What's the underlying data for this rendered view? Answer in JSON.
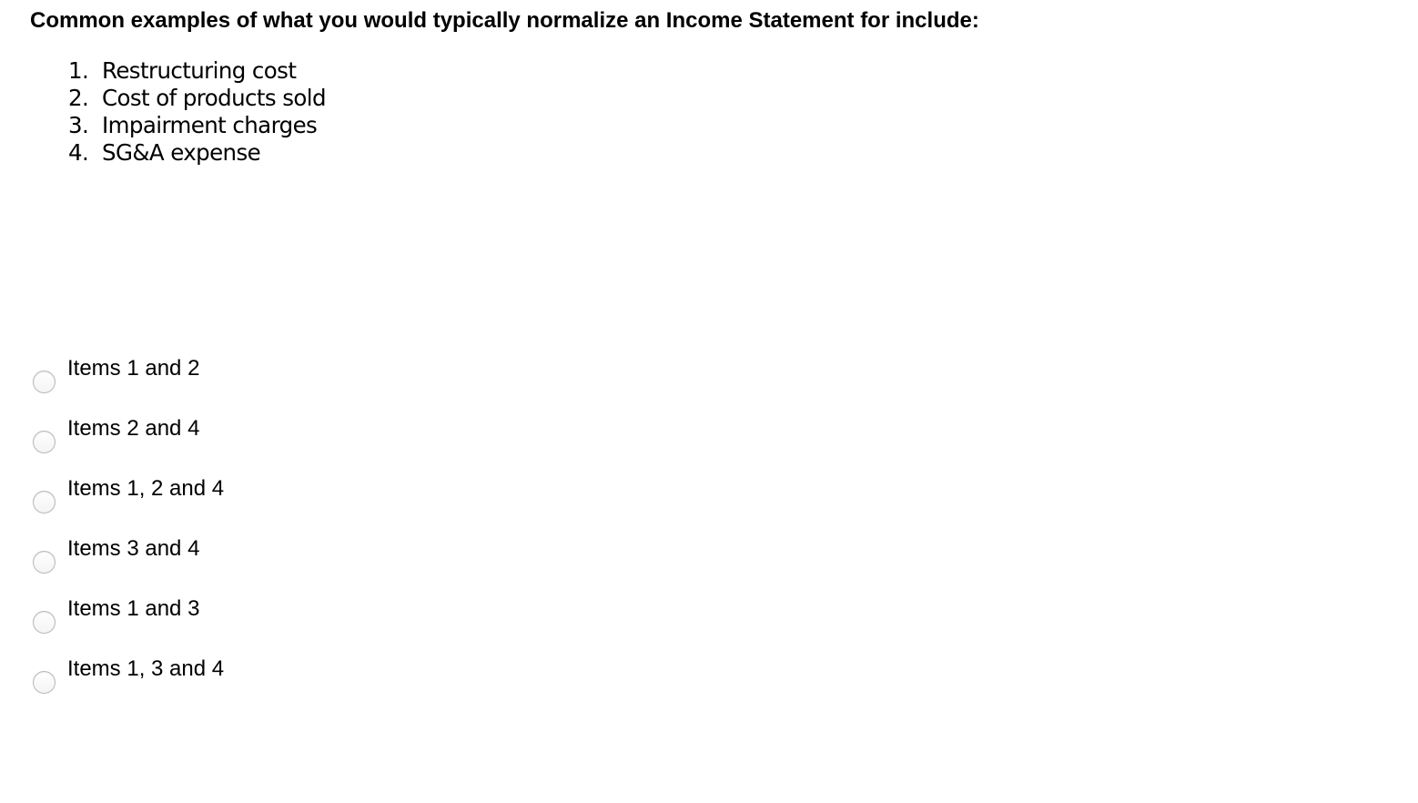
{
  "question": {
    "prompt": "Common examples of what you would typically normalize an Income Statement for include:",
    "examples": [
      {
        "number": "1.",
        "text": "Restructuring cost"
      },
      {
        "number": "2.",
        "text": "Cost of products sold"
      },
      {
        "number": "3.",
        "text": "Impairment charges"
      },
      {
        "number": "4.",
        "text": "SG&A expense"
      }
    ]
  },
  "answers": {
    "selected": null,
    "options": [
      {
        "label": "Items 1 and 2"
      },
      {
        "label": "Items 2 and 4"
      },
      {
        "label": "Items 1, 2 and 4"
      },
      {
        "label": "Items 3 and 4"
      },
      {
        "label": "Items 1 and 3"
      },
      {
        "label": "Items 1, 3 and 4"
      }
    ]
  }
}
